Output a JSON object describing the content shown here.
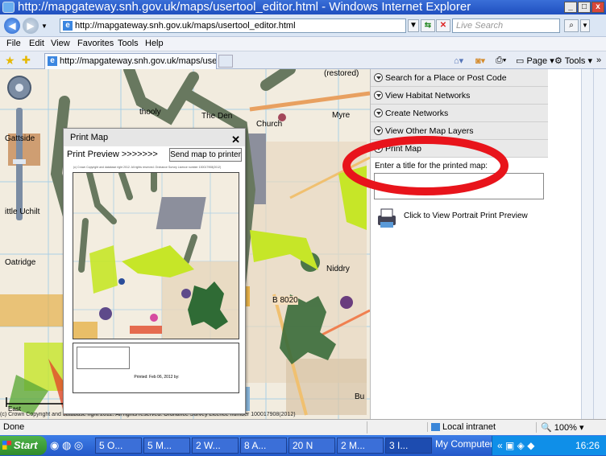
{
  "window": {
    "title": "http://mapgateway.snh.gov.uk/maps/usertool_editor.html - Windows Internet Explorer",
    "minimize": "_",
    "maximize": "□",
    "close": "x"
  },
  "addressbar": {
    "url": "http://mapgateway.snh.gov.uk/maps/usertool_editor.html",
    "search_placeholder": "Live Search"
  },
  "menu": [
    "File",
    "Edit",
    "View",
    "Favorites",
    "Tools",
    "Help"
  ],
  "tab": {
    "label": "http://mapgateway.snh.gov.uk/maps/userto..."
  },
  "commandbar": {
    "page": "Page",
    "tools": "Tools"
  },
  "map_labels": {
    "thoolyt": "thooly",
    "the_den": "The Den",
    "church": "Church",
    "myre": "Myre",
    "restored": "(restored)",
    "gattside": "Gattside",
    "oatridge": "Oatridge",
    "uchilt": "ittle Uchilt",
    "niddry": "Niddry",
    "b8020": "B 8020",
    "bu": "Bu",
    "east": "East",
    "copyright": "(c) Crown Copyright and database right 2012. All rights reserved. Ordnance Survey Licence number 100017908(2012)"
  },
  "panel": {
    "items": [
      "Search for a Place or Post Code",
      "View Habitat Networks",
      "Create Networks",
      "View Other Map Layers",
      "Print Map"
    ],
    "title_prompt": "Enter a title for the printed map:",
    "portrait_link": "Click to View Portrait Print Preview"
  },
  "print_dialog": {
    "title": "Print Map",
    "close": "✕",
    "subtitle": "Print Preview   >>>>>>>",
    "send_button": "Send map to printer",
    "copyright": "(c) Crown Copyright and database right 2012. All rights reserved. Ordnance Survey Licence number 100017908(2012)",
    "printed_date": "Printed: Feb 06, 2012 by:"
  },
  "status": {
    "text": "Done",
    "zone": "Local intranet",
    "zoom": "100%"
  },
  "taskbar": {
    "start": "Start",
    "items": [
      "5 O...",
      "5 M...",
      "2 W...",
      "8 A...",
      "20 N",
      "2 M...",
      "3 I..."
    ],
    "mycomputer": "My Computer",
    "clock": "16:26"
  },
  "colors": {
    "highlight_ellipse": "#e8141b",
    "habitat_green": "#6b7c62",
    "lime": "#c6e628",
    "purple": "#5e4a8a"
  }
}
